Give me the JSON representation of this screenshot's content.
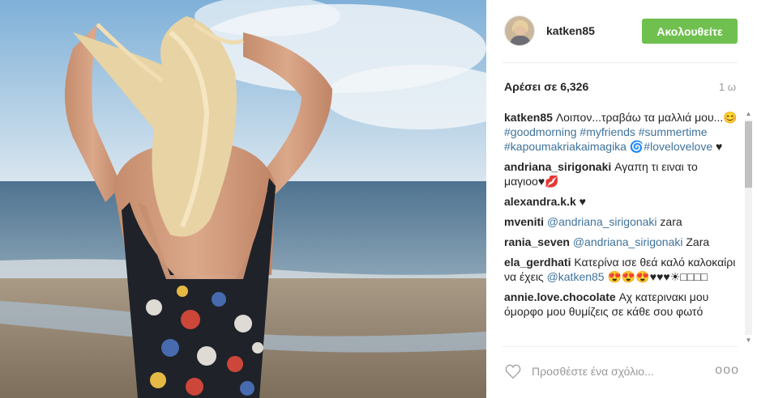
{
  "post": {
    "username": "katken85",
    "follow_label": "Ακολουθείτε",
    "likes": "Αρέσει σε 6,326",
    "time": "1 ω",
    "comments": [
      {
        "user": "katken85",
        "parts": [
          {
            "t": "Λοιπον...τραβάω τα μαλλιά μου...😊 ",
            "tag": false
          },
          {
            "t": "#goodmorning",
            "tag": true
          },
          {
            "t": " ",
            "tag": false
          },
          {
            "t": "#myfriends",
            "tag": true
          },
          {
            "t": " ",
            "tag": false
          },
          {
            "t": "#summertime",
            "tag": true
          },
          {
            "t": " ",
            "tag": false
          },
          {
            "t": "#kapoumakriakaimagika",
            "tag": true
          },
          {
            "t": " 🌀",
            "tag": false
          },
          {
            "t": "#lovelovelove",
            "tag": true
          },
          {
            "t": " ♥",
            "tag": false
          }
        ]
      },
      {
        "user": "andriana_sirigonaki",
        "parts": [
          {
            "t": "Αγαπη τι ειναι το μαγιοο♥💋",
            "tag": false
          }
        ]
      },
      {
        "user": "alexandra.k.k",
        "parts": [
          {
            "t": "♥",
            "tag": false
          }
        ]
      },
      {
        "user": "mveniti",
        "parts": [
          {
            "t": "@andriana_sirigonaki",
            "tag": true
          },
          {
            "t": " zara",
            "tag": false
          }
        ]
      },
      {
        "user": "rania_seven",
        "parts": [
          {
            "t": "@andriana_sirigonaki",
            "tag": true
          },
          {
            "t": " Zara",
            "tag": false
          }
        ]
      },
      {
        "user": "ela_gerdhati",
        "parts": [
          {
            "t": "Κατερίνα ισε θεά καλό καλοκαίρι να έχεις ",
            "tag": false
          },
          {
            "t": "@katken85",
            "tag": true
          },
          {
            "t": " 😍😍😍♥♥♥☀□□□□",
            "tag": false
          }
        ]
      },
      {
        "user": "annie.love.chocolate",
        "parts": [
          {
            "t": "Αχ κατερινακι μου όμορφο μου θυμίζεις σε κάθε σου φωτό",
            "tag": false
          }
        ]
      }
    ],
    "comment_placeholder": "Προσθέστε ένα σχόλιο...",
    "more_label": "ooo"
  },
  "colors": {
    "follow_button": "#70c050",
    "hashtag": "#3f729b"
  }
}
